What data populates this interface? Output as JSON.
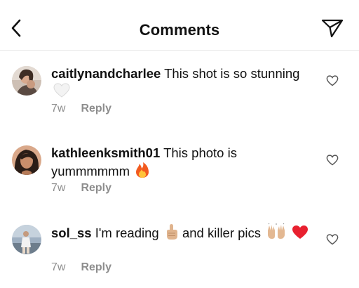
{
  "header": {
    "title": "Comments",
    "back_icon": "chevron-left-icon",
    "send_icon": "paper-plane-icon"
  },
  "comments": [
    {
      "username": "caitlynandcharlee",
      "text": "This shot is so stunning",
      "emojis": [
        "white-heart"
      ],
      "time": "7w",
      "reply_label": "Reply"
    },
    {
      "username": "kathleenksmith01",
      "text": "This photo is yummmmmm",
      "emojis": [
        "fire"
      ],
      "time": "7w",
      "reply_label": "Reply"
    },
    {
      "username": "sol_ss",
      "text_before": "I'm reading",
      "text_after": "and killer pics",
      "emojis": [
        "pointing-up-hand",
        "raising-hands",
        "red-heart"
      ],
      "time": "7w",
      "reply_label": "Reply"
    }
  ],
  "colors": {
    "text": "#111111",
    "meta": "#8e8e8e",
    "divider": "#e8e8e8"
  }
}
